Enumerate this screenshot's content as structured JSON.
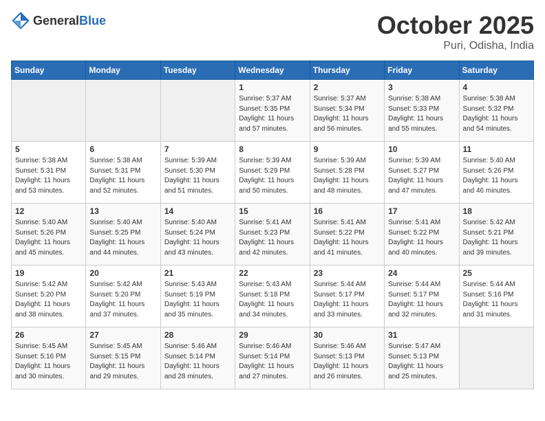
{
  "header": {
    "logo_general": "General",
    "logo_blue": "Blue",
    "title": "October 2025",
    "location": "Puri, Odisha, India"
  },
  "days_of_week": [
    "Sunday",
    "Monday",
    "Tuesday",
    "Wednesday",
    "Thursday",
    "Friday",
    "Saturday"
  ],
  "weeks": [
    [
      {
        "day": "",
        "empty": true
      },
      {
        "day": "",
        "empty": true
      },
      {
        "day": "",
        "empty": true
      },
      {
        "day": "1",
        "sunrise": "5:37 AM",
        "sunset": "5:35 PM",
        "daylight": "11 hours and 57 minutes."
      },
      {
        "day": "2",
        "sunrise": "5:37 AM",
        "sunset": "5:34 PM",
        "daylight": "11 hours and 56 minutes."
      },
      {
        "day": "3",
        "sunrise": "5:38 AM",
        "sunset": "5:33 PM",
        "daylight": "11 hours and 55 minutes."
      },
      {
        "day": "4",
        "sunrise": "5:38 AM",
        "sunset": "5:32 PM",
        "daylight": "11 hours and 54 minutes."
      }
    ],
    [
      {
        "day": "5",
        "sunrise": "5:38 AM",
        "sunset": "5:31 PM",
        "daylight": "11 hours and 53 minutes."
      },
      {
        "day": "6",
        "sunrise": "5:38 AM",
        "sunset": "5:31 PM",
        "daylight": "11 hours and 52 minutes."
      },
      {
        "day": "7",
        "sunrise": "5:39 AM",
        "sunset": "5:30 PM",
        "daylight": "11 hours and 51 minutes."
      },
      {
        "day": "8",
        "sunrise": "5:39 AM",
        "sunset": "5:29 PM",
        "daylight": "11 hours and 50 minutes."
      },
      {
        "day": "9",
        "sunrise": "5:39 AM",
        "sunset": "5:28 PM",
        "daylight": "11 hours and 48 minutes."
      },
      {
        "day": "10",
        "sunrise": "5:39 AM",
        "sunset": "5:27 PM",
        "daylight": "11 hours and 47 minutes."
      },
      {
        "day": "11",
        "sunrise": "5:40 AM",
        "sunset": "5:26 PM",
        "daylight": "11 hours and 46 minutes."
      }
    ],
    [
      {
        "day": "12",
        "sunrise": "5:40 AM",
        "sunset": "5:26 PM",
        "daylight": "11 hours and 45 minutes."
      },
      {
        "day": "13",
        "sunrise": "5:40 AM",
        "sunset": "5:25 PM",
        "daylight": "11 hours and 44 minutes."
      },
      {
        "day": "14",
        "sunrise": "5:40 AM",
        "sunset": "5:24 PM",
        "daylight": "11 hours and 43 minutes."
      },
      {
        "day": "15",
        "sunrise": "5:41 AM",
        "sunset": "5:23 PM",
        "daylight": "11 hours and 42 minutes."
      },
      {
        "day": "16",
        "sunrise": "5:41 AM",
        "sunset": "5:22 PM",
        "daylight": "11 hours and 41 minutes."
      },
      {
        "day": "17",
        "sunrise": "5:41 AM",
        "sunset": "5:22 PM",
        "daylight": "11 hours and 40 minutes."
      },
      {
        "day": "18",
        "sunrise": "5:42 AM",
        "sunset": "5:21 PM",
        "daylight": "11 hours and 39 minutes."
      }
    ],
    [
      {
        "day": "19",
        "sunrise": "5:42 AM",
        "sunset": "5:20 PM",
        "daylight": "11 hours and 38 minutes."
      },
      {
        "day": "20",
        "sunrise": "5:42 AM",
        "sunset": "5:20 PM",
        "daylight": "11 hours and 37 minutes."
      },
      {
        "day": "21",
        "sunrise": "5:43 AM",
        "sunset": "5:19 PM",
        "daylight": "11 hours and 35 minutes."
      },
      {
        "day": "22",
        "sunrise": "5:43 AM",
        "sunset": "5:18 PM",
        "daylight": "11 hours and 34 minutes."
      },
      {
        "day": "23",
        "sunrise": "5:44 AM",
        "sunset": "5:17 PM",
        "daylight": "11 hours and 33 minutes."
      },
      {
        "day": "24",
        "sunrise": "5:44 AM",
        "sunset": "5:17 PM",
        "daylight": "11 hours and 32 minutes."
      },
      {
        "day": "25",
        "sunrise": "5:44 AM",
        "sunset": "5:16 PM",
        "daylight": "11 hours and 31 minutes."
      }
    ],
    [
      {
        "day": "26",
        "sunrise": "5:45 AM",
        "sunset": "5:16 PM",
        "daylight": "11 hours and 30 minutes."
      },
      {
        "day": "27",
        "sunrise": "5:45 AM",
        "sunset": "5:15 PM",
        "daylight": "11 hours and 29 minutes."
      },
      {
        "day": "28",
        "sunrise": "5:46 AM",
        "sunset": "5:14 PM",
        "daylight": "11 hours and 28 minutes."
      },
      {
        "day": "29",
        "sunrise": "5:46 AM",
        "sunset": "5:14 PM",
        "daylight": "11 hours and 27 minutes."
      },
      {
        "day": "30",
        "sunrise": "5:46 AM",
        "sunset": "5:13 PM",
        "daylight": "11 hours and 26 minutes."
      },
      {
        "day": "31",
        "sunrise": "5:47 AM",
        "sunset": "5:13 PM",
        "daylight": "11 hours and 25 minutes."
      },
      {
        "day": "",
        "empty": true
      }
    ]
  ]
}
